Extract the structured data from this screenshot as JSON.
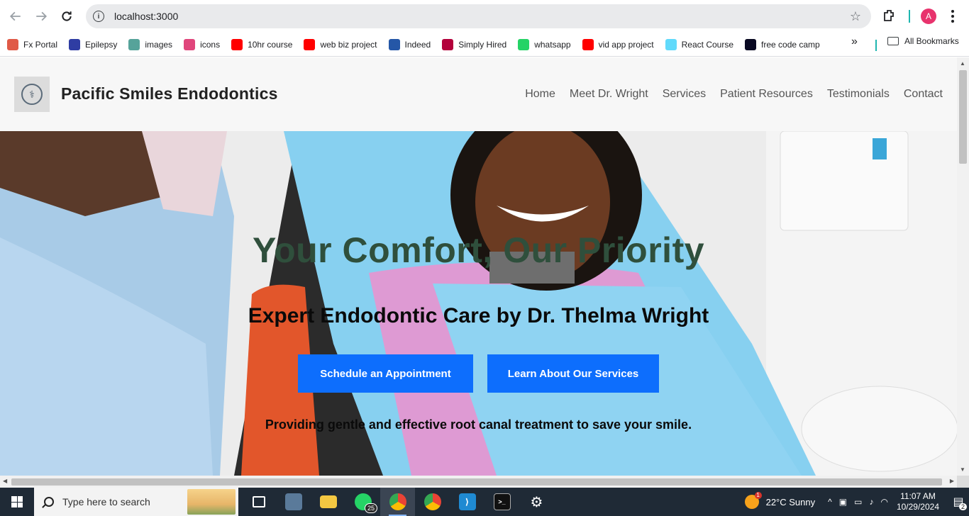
{
  "browser": {
    "url": "localhost:3000",
    "bookmarks": [
      {
        "label": "Fx Portal",
        "icon": "bar-chart-icon",
        "color": "#e05a47"
      },
      {
        "label": "Epilepsy",
        "icon": "yahoo-icon",
        "color": "#2f3da3"
      },
      {
        "label": "images",
        "icon": "d-icon",
        "color": "#56a39a"
      },
      {
        "label": "icons",
        "icon": "react-icon",
        "color": "#e0467c"
      },
      {
        "label": "10hr course",
        "icon": "youtube-icon",
        "color": "#ff0000"
      },
      {
        "label": "web biz project",
        "icon": "youtube-icon",
        "color": "#ff0000"
      },
      {
        "label": "Indeed",
        "icon": "indeed-icon",
        "color": "#2557a7"
      },
      {
        "label": "Simply Hired",
        "icon": "s-icon",
        "color": "#b3003b"
      },
      {
        "label": "whatsapp",
        "icon": "whatsapp-icon",
        "color": "#25d366"
      },
      {
        "label": "vid app project",
        "icon": "youtube-icon",
        "color": "#ff0000"
      },
      {
        "label": "React Course",
        "icon": "react-icon",
        "color": "#61dafb"
      },
      {
        "label": "free code camp",
        "icon": "fcc-icon",
        "color": "#0a0a23"
      }
    ],
    "more": "»",
    "all_bookmarks": "All Bookmarks",
    "profile_initial": "A"
  },
  "site": {
    "brand": "Pacific Smiles Endodontics",
    "nav": [
      "Home",
      "Meet Dr. Wright",
      "Services",
      "Patient Resources",
      "Testimonials",
      "Contact"
    ]
  },
  "hero": {
    "title": "Your Comfort, Our Priority",
    "subtitle": "Expert Endodontic Care by Dr. Thelma Wright",
    "primary_button": "Schedule an Appointment",
    "secondary_button": "Learn About Our Services",
    "tagline": "Providing gentle and effective root canal treatment to save your smile.",
    "accent_color": "#0d6efd",
    "title_color": "#2f4f3c"
  },
  "taskbar": {
    "search_placeholder": "Type here to search",
    "whatsapp_badge": "25",
    "weather": "22°C  Sunny",
    "time": "11:07 AM",
    "date": "10/29/2024",
    "notifications": "2"
  }
}
